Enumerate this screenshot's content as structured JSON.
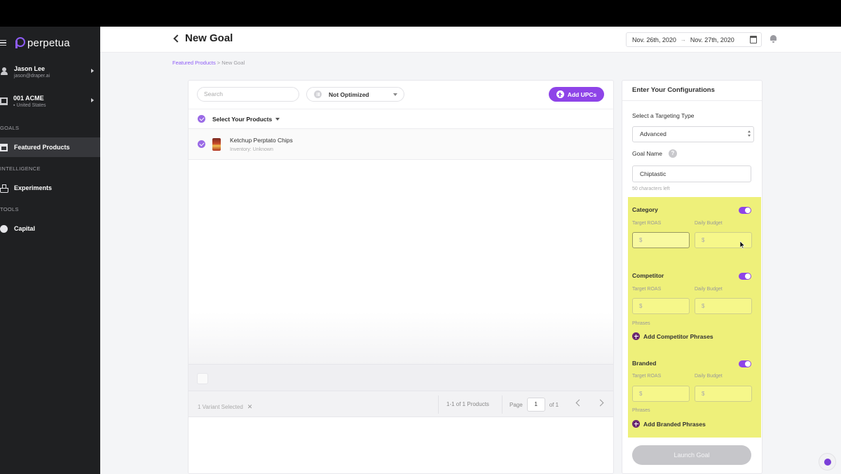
{
  "brand": {
    "name": "perpetua",
    "accent": "#8e44e8"
  },
  "sidebar": {
    "user": {
      "name": "Jason Lee",
      "email": "jason@draper.ai"
    },
    "account": {
      "name": "001 ACME",
      "country": "United States"
    },
    "sections": [
      {
        "label": "GOALS",
        "items": [
          {
            "label": "Featured Products",
            "icon": "store-icon",
            "active": true
          }
        ]
      },
      {
        "label": "INTELLIGENCE",
        "items": [
          {
            "label": "Experiments",
            "icon": "flask-icon",
            "active": false
          }
        ]
      },
      {
        "label": "TOOLS",
        "items": [
          {
            "label": "Capital",
            "icon": "coin-icon",
            "active": false
          }
        ]
      }
    ]
  },
  "header": {
    "title": "New Goal",
    "date_start": "Nov. 26th, 2020",
    "date_arrow": "→",
    "date_end": "Nov. 27th, 2020"
  },
  "breadcrumb": {
    "parent": "Featured Products",
    "separator": " > ",
    "current": "New Goal"
  },
  "products": {
    "search_placeholder": "Search",
    "filter_value": "Not Optimized",
    "add_button": "Add UPCs",
    "select_label": "Select Your Products",
    "items": [
      {
        "name": "Ketchup Perptato Chips",
        "inventory": "Inventory: Unknown"
      }
    ],
    "variant_selected": "1 Variant Selected",
    "range_text": "1-1 of 1 Products",
    "page_label": "Page",
    "page_value": "1",
    "page_of": "of 1"
  },
  "config": {
    "title": "Enter Your Configurations",
    "targeting_label": "Select a Targeting Type",
    "targeting_value": "Advanced",
    "goal_name_label": "Goal Name",
    "help_glyph": "?",
    "goal_name_value": "Chiptastic",
    "chars_left": "50 characters left",
    "roas_label": "Target ROAS",
    "budget_label": "Daily Budget",
    "currency_placeholder": "$",
    "phrases_label": "Phrases",
    "sections": [
      {
        "name": "Category",
        "enabled": true
      },
      {
        "name": "Competitor",
        "enabled": true,
        "add_phrases": "Add Competitor Phrases"
      },
      {
        "name": "Branded",
        "enabled": true,
        "add_phrases": "Add Branded Phrases"
      }
    ],
    "launch_button": "Launch Goal"
  }
}
